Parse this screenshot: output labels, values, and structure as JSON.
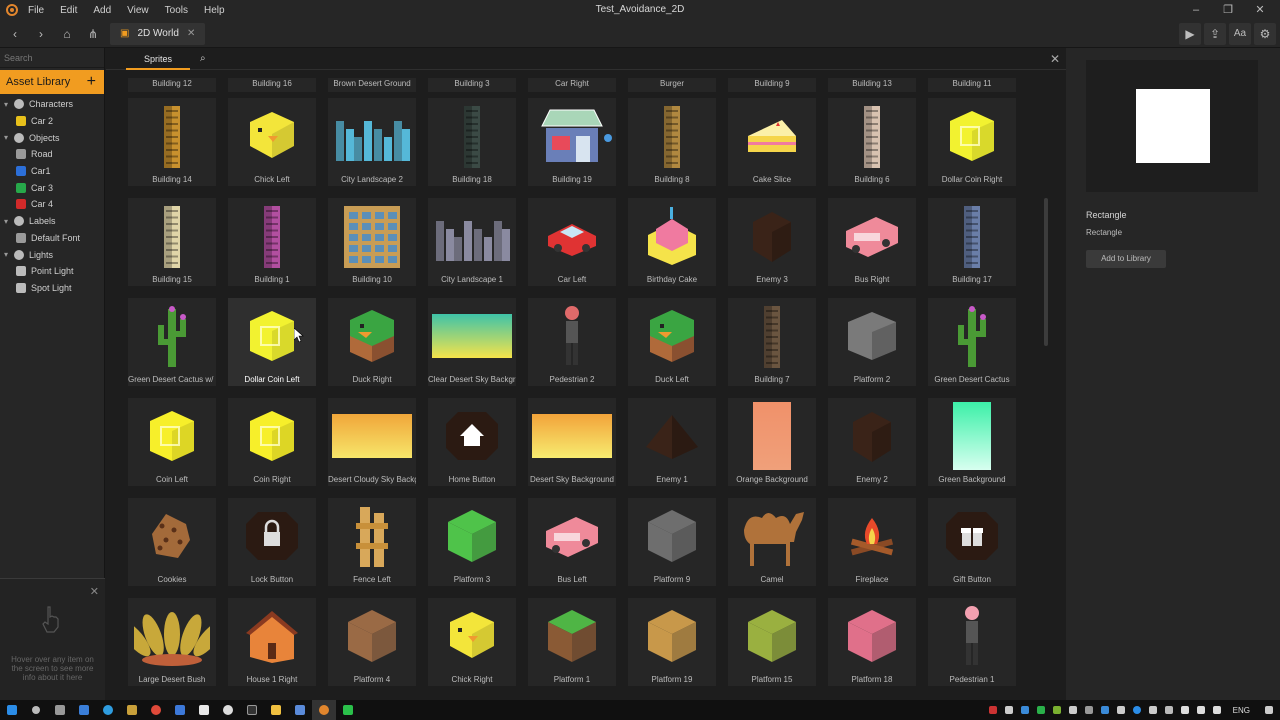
{
  "window": {
    "title": "Test_Avoidance_2D"
  },
  "menu": [
    "File",
    "Edit",
    "Add",
    "View",
    "Tools",
    "Help"
  ],
  "toolbar": {
    "tab_label": "2D World",
    "aa_label": "Aa"
  },
  "left": {
    "search_placeholder": "Search",
    "asset_library": "Asset Library",
    "tree": [
      {
        "label": "Characters",
        "level": 0,
        "color": "#bbbbbb"
      },
      {
        "label": "Car 2",
        "level": 1,
        "color": "#e7c01b"
      },
      {
        "label": "Objects",
        "level": 0,
        "color": "#bbbbbb"
      },
      {
        "label": "Road",
        "level": 1,
        "color": "#9a9a9a"
      },
      {
        "label": "Car1",
        "level": 1,
        "color": "#2c6fd8"
      },
      {
        "label": "Car 3",
        "level": 1,
        "color": "#27a84a"
      },
      {
        "label": "Car 4",
        "level": 1,
        "color": "#d12a2a"
      },
      {
        "label": "Labels",
        "level": 0,
        "color": "#bbbbbb"
      },
      {
        "label": "Default Font",
        "level": 1,
        "color": "#9a9a9a"
      },
      {
        "label": "Lights",
        "level": 0,
        "color": "#bbbbbb"
      },
      {
        "label": "Point Light",
        "level": 1,
        "color": "#bbbbbb"
      },
      {
        "label": "Spot Light",
        "level": 1,
        "color": "#bbbbbb"
      }
    ],
    "hover_message": "Hover over any item on the screen to see more info about it here"
  },
  "center": {
    "tab": "Sprites",
    "top_row": [
      "Building 12",
      "Building 16",
      "Brown Desert Ground",
      "Building 3",
      "Car Right",
      "Burger",
      "Building 9",
      "Building 13",
      "Building 11"
    ],
    "rows": [
      [
        {
          "label": "Building 14",
          "kind": "tower",
          "color": "#c8912e"
        },
        {
          "label": "Chick Left",
          "kind": "chick",
          "color": "#f3e53a"
        },
        {
          "label": "City Landscape 2",
          "kind": "city",
          "color": "#55b8d8"
        },
        {
          "label": "Building 18",
          "kind": "tower",
          "color": "#3b4a45"
        },
        {
          "label": "Building 19",
          "kind": "shop",
          "color": "#6a7fb8"
        },
        {
          "label": "Building 8",
          "kind": "tower",
          "color": "#b08840"
        },
        {
          "label": "Cake Slice",
          "kind": "cake",
          "color": "#f5d54a"
        },
        {
          "label": "Building 6",
          "kind": "tower",
          "color": "#d8c2b0"
        },
        {
          "label": "Dollar Coin Right",
          "kind": "coin",
          "color": "#f2f230"
        }
      ],
      [
        {
          "label": "Building 15",
          "kind": "tower",
          "color": "#e0d5a8"
        },
        {
          "label": "Building 1",
          "kind": "tower",
          "color": "#b24fa0"
        },
        {
          "label": "Building 10",
          "kind": "block",
          "color": "#c89d55"
        },
        {
          "label": "City Landscape 1",
          "kind": "city",
          "color": "#8a8aa0"
        },
        {
          "label": "Car Left",
          "kind": "car",
          "color": "#e03333"
        },
        {
          "label": "Birthday Cake",
          "kind": "bcake",
          "color": "#f07aa0"
        },
        {
          "label": "Enemy 3",
          "kind": "enemy",
          "color": "#3a2318"
        },
        {
          "label": "Bus Right",
          "kind": "bus",
          "color": "#ef8a9a"
        },
        {
          "label": "Building 17",
          "kind": "tower",
          "color": "#6a7ea8"
        }
      ],
      [
        {
          "label": "Green Desert Cactus w/ Moss",
          "kind": "cactus",
          "color": "#4a9a35"
        },
        {
          "label": "Dollar Coin Left",
          "kind": "coin",
          "color": "#f2f230",
          "selected": true
        },
        {
          "label": "Duck Right",
          "kind": "duck",
          "color": "#3aa542"
        },
        {
          "label": "Clear Desert Sky Background",
          "kind": "grad",
          "color": "#3fc3a8",
          "color2": "#f5e34a"
        },
        {
          "label": "Pedestrian 2",
          "kind": "person",
          "color": "#e06a6a"
        },
        {
          "label": "Duck Left",
          "kind": "duck",
          "color": "#3aa542"
        },
        {
          "label": "Building 7",
          "kind": "tower",
          "color": "#6a5540"
        },
        {
          "label": "Platform 2",
          "kind": "stone",
          "color": "#7a7a7a"
        },
        {
          "label": "Green Desert Cactus",
          "kind": "cactus",
          "color": "#4a9a35"
        }
      ],
      [
        {
          "label": "Coin Left",
          "kind": "coin",
          "color": "#f7ef2a"
        },
        {
          "label": "Coin Right",
          "kind": "coin",
          "color": "#f7ef2a"
        },
        {
          "label": "Desert Cloudy Sky Background",
          "kind": "grad",
          "color": "#f0a63a",
          "color2": "#f7e66a"
        },
        {
          "label": "Home Button",
          "kind": "homebtn",
          "color": "#2b1a12"
        },
        {
          "label": "Desert Sky Background",
          "kind": "grad",
          "color": "#f2a33a",
          "color2": "#f7ec70"
        },
        {
          "label": "Enemy 1",
          "kind": "pyramid",
          "color": "#3a2318"
        },
        {
          "label": "Orange Background",
          "kind": "vgrad",
          "color": "#f0916a",
          "color2": "#f0a07a"
        },
        {
          "label": "Enemy 2",
          "kind": "enemy",
          "color": "#3a2318"
        },
        {
          "label": "Green Background",
          "kind": "vgrad",
          "color": "#3cf0a8",
          "color2": "#d8fff0"
        }
      ],
      [
        {
          "label": "Cookies",
          "kind": "cookie",
          "color": "#a36a3a"
        },
        {
          "label": "Lock Button",
          "kind": "lockbtn",
          "color": "#2b1a12"
        },
        {
          "label": "Fence Left",
          "kind": "fence",
          "color": "#d8a85a"
        },
        {
          "label": "Platform 3",
          "kind": "cube",
          "color": "#4fc34a"
        },
        {
          "label": "Bus Left",
          "kind": "bus",
          "color": "#ef8a9a"
        },
        {
          "label": "Platform 9",
          "kind": "cube",
          "color": "#6e6e6e"
        },
        {
          "label": "Camel",
          "kind": "camel",
          "color": "#b0723a"
        },
        {
          "label": "Fireplace",
          "kind": "fire",
          "color": "#e84a2a"
        },
        {
          "label": "Gift Button",
          "kind": "giftbtn",
          "color": "#2b1a12"
        }
      ],
      [
        {
          "label": "Large Desert Bush",
          "kind": "bush",
          "color": "#c8a83a"
        },
        {
          "label": "House 1 Right",
          "kind": "house",
          "color": "#e8843a"
        },
        {
          "label": "Platform 4",
          "kind": "cube",
          "color": "#9a6a45"
        },
        {
          "label": "Chick Right",
          "kind": "chick",
          "color": "#f3e53a"
        },
        {
          "label": "Platform 1",
          "kind": "cube",
          "color": "#8a5a35",
          "top": "#4fb545"
        },
        {
          "label": "Platform 19",
          "kind": "cube",
          "color": "#c8984a"
        },
        {
          "label": "Platform 15",
          "kind": "cube",
          "color": "#9ab040"
        },
        {
          "label": "Platform 18",
          "kind": "cube",
          "color": "#e0708a"
        },
        {
          "label": "Pedestrian 1",
          "kind": "person",
          "color": "#f3a0b0"
        }
      ]
    ]
  },
  "right": {
    "title": "Rectangle",
    "subtitle": "Rectangle",
    "add_button": "Add to Library"
  },
  "taskbar": {
    "lang": "ENG"
  }
}
